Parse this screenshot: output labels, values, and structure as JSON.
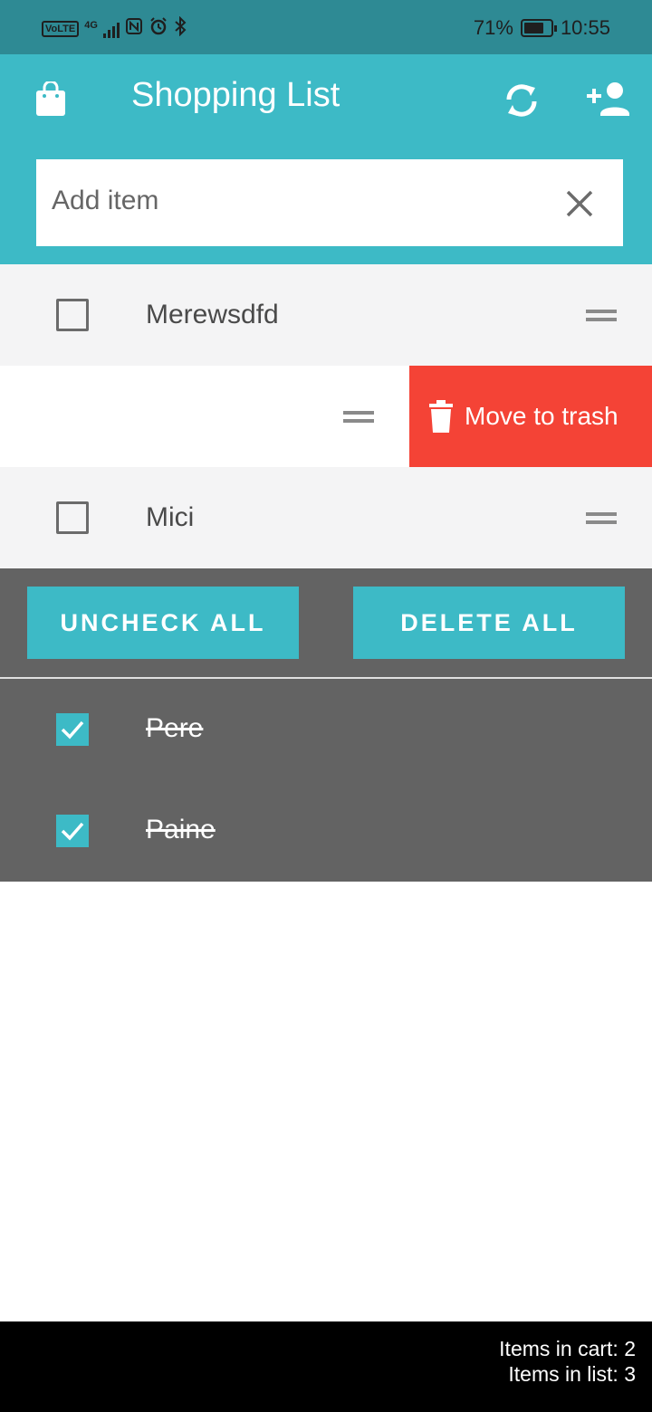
{
  "status_bar": {
    "battery": "71%",
    "time": "10:55",
    "network": "4G",
    "volte": "VoLTE"
  },
  "app_bar": {
    "title": "Shopping List"
  },
  "add_item": {
    "placeholder": "Add item"
  },
  "unchecked_items": [
    {
      "label": "Merewsdfd"
    },
    {
      "label": "",
      "swipe_action": "Move to trash"
    },
    {
      "label": "Mici"
    }
  ],
  "actions": {
    "uncheck_all": "UNCHECK ALL",
    "delete_all": "DELETE ALL"
  },
  "checked_items": [
    {
      "label": "Pere"
    },
    {
      "label": "Paine"
    }
  ],
  "footer": {
    "cart_count": "Items in cart: 2",
    "list_count": "Items in list: 3"
  },
  "colors": {
    "primary": "#3dbac6",
    "status_bar": "#2e8a94",
    "danger": "#f44336",
    "checked_bg": "#636363",
    "list_bg": "#f4f4f5"
  },
  "icons": [
    "shopping-bag-icon",
    "sync-icon",
    "person-add-icon",
    "close-icon",
    "drag-handle-icon",
    "trash-icon",
    "check-icon"
  ]
}
